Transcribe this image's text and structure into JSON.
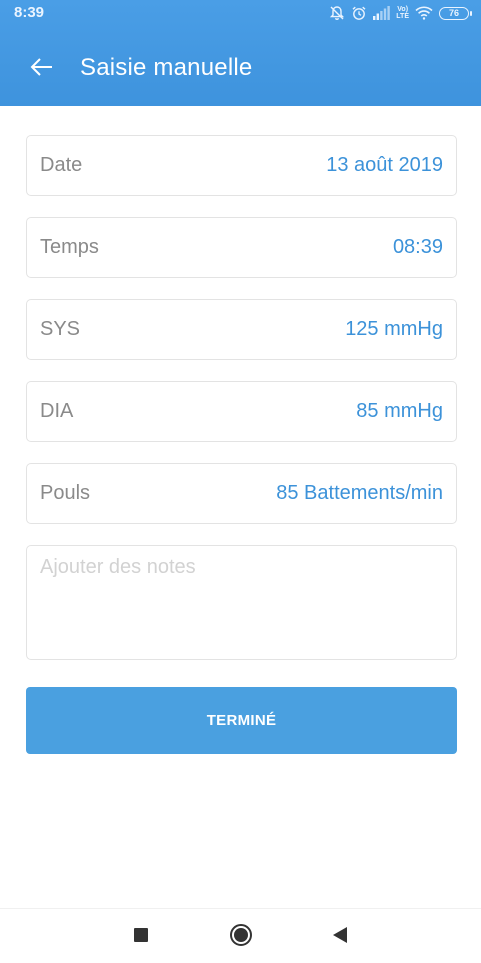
{
  "status_bar": {
    "time": "8:39",
    "network_label_top": "Vo)",
    "network_label_bottom": "LTE",
    "battery": "76",
    "icons": [
      "notifications-off-icon",
      "alarm-icon",
      "signal-icon",
      "volte-lte-icon",
      "wifi-icon",
      "battery-icon"
    ]
  },
  "app_bar": {
    "back_icon": "arrow-left-icon",
    "title": "Saisie manuelle"
  },
  "form": {
    "fields": [
      {
        "label": "Date",
        "value": "13 août 2019"
      },
      {
        "label": "Temps",
        "value": "08:39"
      },
      {
        "label": "SYS",
        "value": "125 mmHg"
      },
      {
        "label": "DIA",
        "value": "85 mmHg"
      },
      {
        "label": "Pouls",
        "value": "85 Battements/min"
      }
    ],
    "notes_placeholder": "Ajouter des notes",
    "notes_value": "",
    "done_label": "TERMINÉ"
  },
  "nav_bar": {
    "icons": [
      "recents-square-icon",
      "home-circle-icon",
      "back-triangle-icon"
    ]
  },
  "colors": {
    "header": "#3e93dd",
    "accent_text": "#3c92d9",
    "button": "#4aa0e0",
    "label_text": "#8a8a8a",
    "border": "#e3e3e3"
  }
}
